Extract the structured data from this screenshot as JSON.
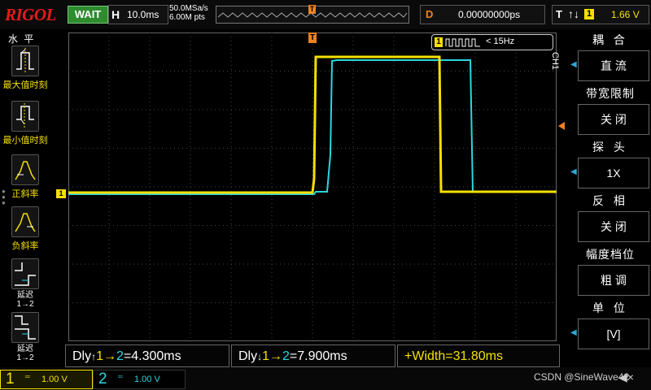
{
  "header": {
    "brand": "RIGOL",
    "run_status": "WAIT",
    "timebase_key": "H",
    "timebase_value": "10.0ms",
    "sample_rate": "50.0MSa/s",
    "memory_depth": "6.00M pts",
    "delay_key": "D",
    "delay_value": "0.00000000ps",
    "trigger_key": "T",
    "trigger_edge": "↑↓",
    "trigger_source": "1",
    "trigger_level": "1.66 V"
  },
  "left_menu": {
    "title": "水 平",
    "items": [
      {
        "label": "最大值时刻"
      },
      {
        "label": "最小值时刻"
      },
      {
        "label": "正斜率"
      },
      {
        "label": "负斜率"
      },
      {
        "label": "延迟",
        "sub": "1→2",
        "edge": "rising"
      },
      {
        "label": "延迟",
        "sub": "1→2",
        "edge": "falling"
      }
    ]
  },
  "right_menu": {
    "channel_tag": "CH1",
    "items": [
      {
        "title": "耦 合",
        "value": "直 流",
        "arrow": true
      },
      {
        "title": "带宽限制",
        "value": "关 闭",
        "arrow": false
      },
      {
        "title": "探 头",
        "value": "1X",
        "arrow": true
      },
      {
        "title": "反 相",
        "value": "关 闭",
        "arrow": false
      },
      {
        "title": "幅度档位",
        "value": "粗 调",
        "arrow": false
      },
      {
        "title": "单 位",
        "value": "[V]",
        "arrow": true
      }
    ]
  },
  "screen": {
    "frequency_badge_channel": "1",
    "frequency_text": "< 15Hz",
    "ch1_marker": "1",
    "trigger_marker": "T"
  },
  "measurements": [
    {
      "prefix": "Dly",
      "edge": "↑",
      "from": "1",
      "arrow": "→",
      "to": "2",
      "value": "=4.300ms"
    },
    {
      "prefix": "Dly",
      "edge": "↓",
      "from": "1",
      "arrow": "→",
      "to": "2",
      "value": "=7.900ms"
    },
    {
      "prefix": "+Width",
      "value": "=31.80ms"
    }
  ],
  "channels": [
    {
      "number": "1",
      "coupling": "DC",
      "scale": "1.00 V",
      "color": "#f5e000"
    },
    {
      "number": "2",
      "coupling": "DC",
      "scale": "1.00 V",
      "color": "#2ad7e0"
    }
  ],
  "watermark": "CSDN @SineWave42",
  "colors": {
    "ch1": "#f5e000",
    "ch2": "#2ad7e0",
    "trigger": "#f0821e",
    "brand": "#e31b1b"
  }
}
